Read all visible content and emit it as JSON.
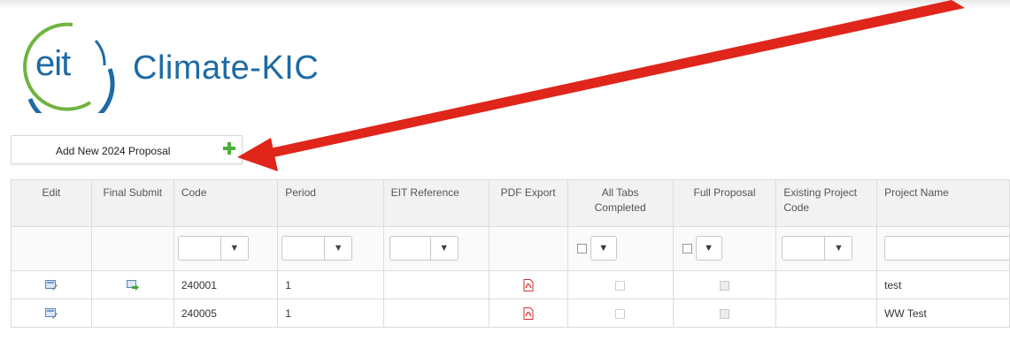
{
  "logo": {
    "eit_text": "eit",
    "name_text": "Climate-KIC"
  },
  "toolbar": {
    "add_button_label": "Add New 2024 Proposal",
    "add_icon": "plus-icon"
  },
  "grid": {
    "columns": [
      {
        "label": "Edit"
      },
      {
        "label": "Final Submit"
      },
      {
        "label": "Code"
      },
      {
        "label": "Period"
      },
      {
        "label": "EIT Reference"
      },
      {
        "label": "PDF Export"
      },
      {
        "label": "All Tabs Completed"
      },
      {
        "label": "Full Proposal"
      },
      {
        "label": "Existing Project Code"
      },
      {
        "label": "Project Name"
      }
    ],
    "filter_icon": "funnel-icon",
    "rows": [
      {
        "code": "240001",
        "period": "1",
        "eit_reference": "",
        "project_name": "test",
        "final_submit_icon": "submit-arrow-icon",
        "all_tabs_completed": false,
        "full_proposal": false
      },
      {
        "code": "240005",
        "period": "1",
        "eit_reference": "",
        "project_name": "WW Test",
        "final_submit_icon": "",
        "all_tabs_completed": false,
        "full_proposal": false
      }
    ]
  },
  "colors": {
    "brand_blue": "#1d6aa5",
    "brand_green": "#6fb43f",
    "arrow_red": "#e0251b"
  }
}
